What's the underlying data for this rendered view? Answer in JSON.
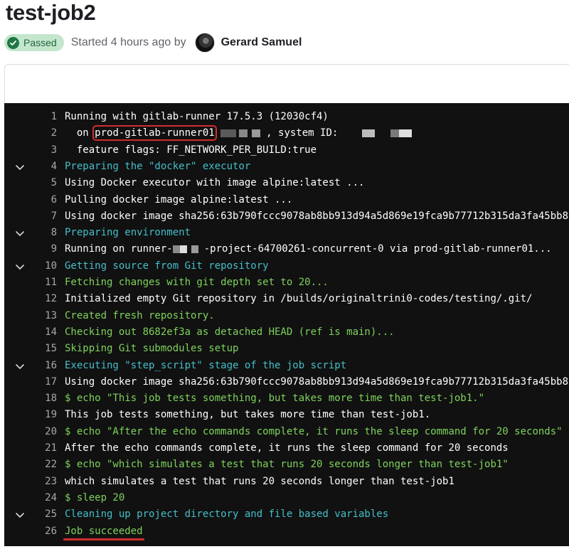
{
  "job": {
    "title": "test-job2",
    "status": "Passed",
    "started_text": "Started 4 hours ago by",
    "user": "Gerard Samuel"
  },
  "colors": {
    "log_bg": "#111111",
    "default": "#ffffff",
    "cyan": "#45bec9",
    "green": "#7ed35d",
    "line_number": "#a8a8a8",
    "passed_bg": "#c3e6cd",
    "passed_text": "#24663b",
    "highlight": "#d42c2c"
  },
  "log": [
    {
      "n": "1",
      "color": "default",
      "text": "Running with gitlab-runner 17.5.3 (12030cf4)"
    },
    {
      "n": "2",
      "color": "default",
      "parts": [
        "  on ",
        "prod-gitlab-runner01",
        " , system ID:"
      ]
    },
    {
      "n": "3",
      "color": "default",
      "text": "  feature flags: FF_NETWORK_PER_BUILD:true"
    },
    {
      "n": "4",
      "color": "cyan",
      "section": true,
      "text": "Preparing the \"docker\" executor"
    },
    {
      "n": "5",
      "color": "default",
      "text": "Using Docker executor with image alpine:latest ..."
    },
    {
      "n": "6",
      "color": "default",
      "text": "Pulling docker image alpine:latest ..."
    },
    {
      "n": "7",
      "color": "default",
      "text": "Using docker image sha256:63b790fccc9078ab8bb913d94a5d869e19fca9b77712b315da3fa45bb8"
    },
    {
      "n": "8",
      "color": "cyan",
      "section": true,
      "text": "Preparing environment"
    },
    {
      "n": "9",
      "color": "default",
      "parts": [
        "Running on runner-",
        "-project-64700261-concurrent-0 via prod-gitlab-runner01..."
      ]
    },
    {
      "n": "10",
      "color": "cyan",
      "section": true,
      "text": "Getting source from Git repository"
    },
    {
      "n": "11",
      "color": "green",
      "text": "Fetching changes with git depth set to 20..."
    },
    {
      "n": "12",
      "color": "default",
      "text": "Initialized empty Git repository in /builds/originaltrini0-codes/testing/.git/"
    },
    {
      "n": "13",
      "color": "green",
      "text": "Created fresh repository."
    },
    {
      "n": "14",
      "color": "green",
      "text": "Checking out 8682ef3a as detached HEAD (ref is main)..."
    },
    {
      "n": "15",
      "color": "green",
      "text": "Skipping Git submodules setup"
    },
    {
      "n": "16",
      "color": "cyan",
      "section": true,
      "text": "Executing \"step_script\" stage of the job script"
    },
    {
      "n": "17",
      "color": "default",
      "text": "Using docker image sha256:63b790fccc9078ab8bb913d94a5d869e19fca9b77712b315da3fa45bb8"
    },
    {
      "n": "18",
      "color": "green",
      "text": "$ echo \"This job tests something, but takes more time than test-job1.\""
    },
    {
      "n": "19",
      "color": "default",
      "text": "This job tests something, but takes more time than test-job1."
    },
    {
      "n": "20",
      "color": "green",
      "text": "$ echo \"After the echo commands complete, it runs the sleep command for 20 seconds\""
    },
    {
      "n": "21",
      "color": "default",
      "text": "After the echo commands complete, it runs the sleep command for 20 seconds"
    },
    {
      "n": "22",
      "color": "green",
      "text": "$ echo \"which simulates a test that runs 20 seconds longer than test-job1\""
    },
    {
      "n": "23",
      "color": "default",
      "text": "which simulates a test that runs 20 seconds longer than test-job1"
    },
    {
      "n": "24",
      "color": "green",
      "text": "$ sleep 20"
    },
    {
      "n": "25",
      "color": "cyan",
      "section": true,
      "text": "Cleaning up project directory and file based variables"
    },
    {
      "n": "26",
      "color": "green",
      "text": "Job succeeded"
    }
  ]
}
